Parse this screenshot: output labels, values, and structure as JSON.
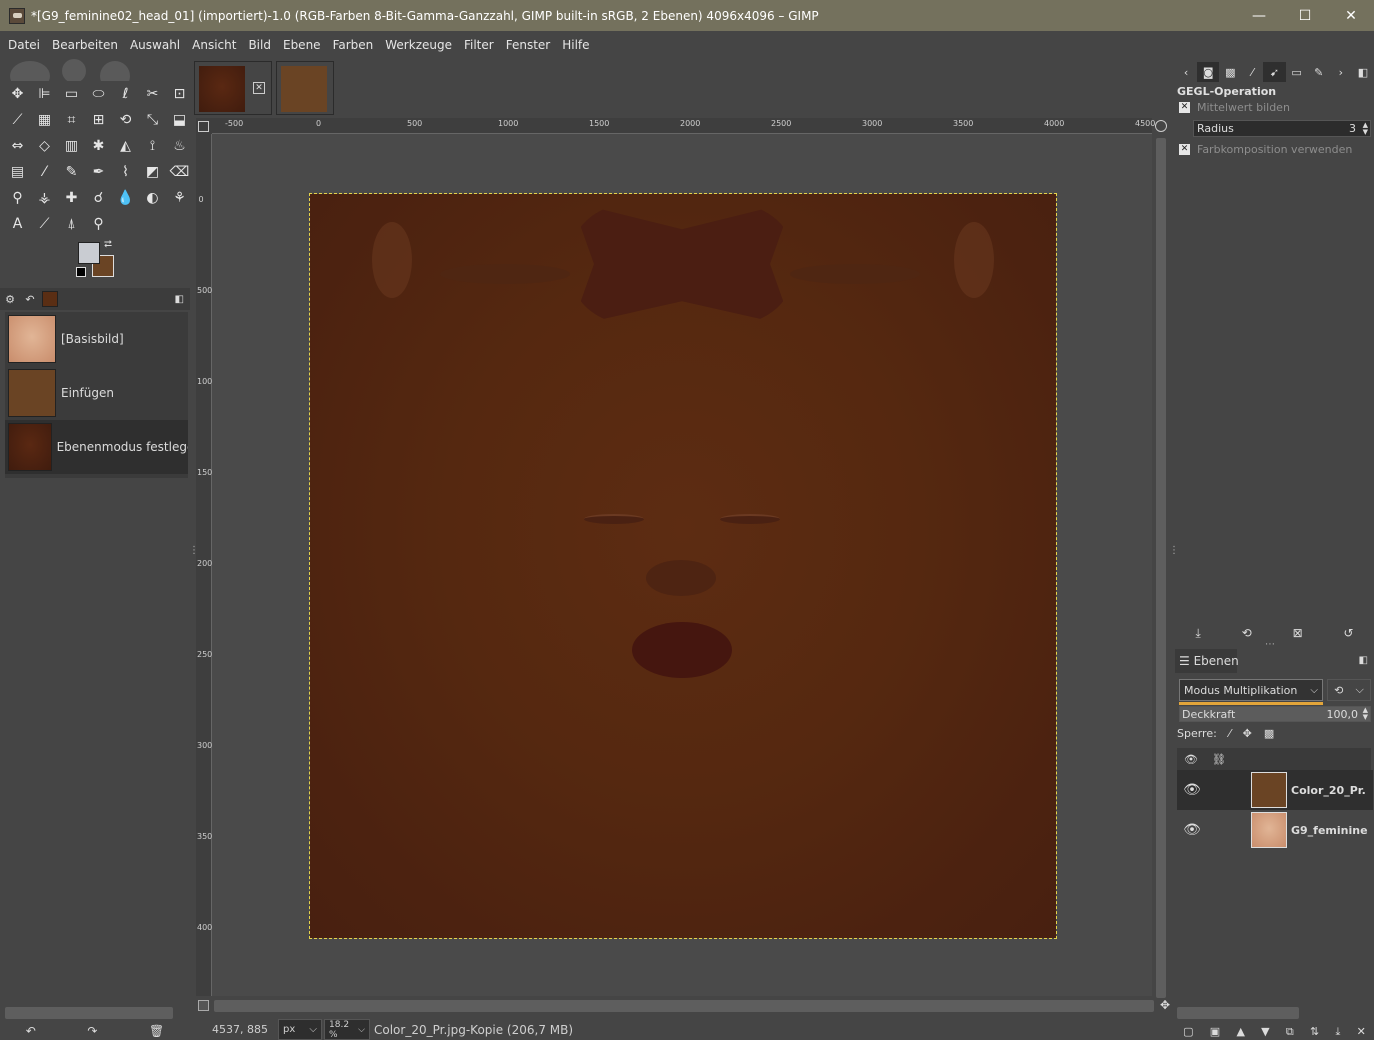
{
  "window": {
    "title": "*[G9_feminine02_head_01] (importiert)-1.0 (RGB-Farben 8-Bit-Gamma-Ganzzahl, GIMP built-in sRGB, 2 Ebenen) 4096x4096 – GIMP",
    "minimize": "—",
    "maximize": "☐",
    "close": "✕"
  },
  "menu": [
    "Datei",
    "Bearbeiten",
    "Auswahl",
    "Ansicht",
    "Bild",
    "Ebene",
    "Farben",
    "Werkzeuge",
    "Filter",
    "Fenster",
    "Hilfe"
  ],
  "toolbox": {
    "tools": [
      {
        "name": "move-tool-icon",
        "glyph": "✥"
      },
      {
        "name": "align-tool-icon",
        "glyph": "⊫"
      },
      {
        "name": "rect-select-icon",
        "glyph": "▭"
      },
      {
        "name": "ellipse-select-icon",
        "glyph": "⬭"
      },
      {
        "name": "free-select-icon",
        "glyph": "ℓ"
      },
      {
        "name": "scissors-select-icon",
        "glyph": "✂"
      },
      {
        "name": "foreground-select-icon",
        "glyph": "⊡"
      },
      {
        "name": "fuzzy-select-icon",
        "glyph": "⟋"
      },
      {
        "name": "color-select-icon",
        "glyph": "▦"
      },
      {
        "name": "crop-tool-icon",
        "glyph": "⌗"
      },
      {
        "name": "unified-transform-icon",
        "glyph": "⊞"
      },
      {
        "name": "warp-transform-icon",
        "glyph": "⟲"
      },
      {
        "name": "handle-transform-icon",
        "glyph": "⤡"
      },
      {
        "name": "shear-tool-icon",
        "glyph": "⬓"
      },
      {
        "name": "flip-tool-icon",
        "glyph": "⇔"
      },
      {
        "name": "perspective-tool-icon",
        "glyph": "◇"
      },
      {
        "name": "cage-transform-icon",
        "glyph": "▥"
      },
      {
        "name": "gegl-op-icon",
        "glyph": "✱"
      },
      {
        "name": "bucket-fill-icon",
        "glyph": "◭"
      },
      {
        "name": "paths-tool-icon",
        "glyph": "⟟"
      },
      {
        "name": "smudge-tool-icon",
        "glyph": "♨"
      },
      {
        "name": "gradient-tool-icon",
        "glyph": "▤"
      },
      {
        "name": "paintbrush-icon",
        "glyph": "⁄"
      },
      {
        "name": "pencil-icon",
        "glyph": "✎"
      },
      {
        "name": "airbrush-icon",
        "glyph": "✒"
      },
      {
        "name": "ink-tool-icon",
        "glyph": "⌇"
      },
      {
        "name": "mypaint-brush-icon",
        "glyph": "◩"
      },
      {
        "name": "eraser-icon",
        "glyph": "⌫"
      },
      {
        "name": "clone-tool-icon",
        "glyph": "⚲"
      },
      {
        "name": "perspective-clone-icon",
        "glyph": "⚶"
      },
      {
        "name": "heal-tool-icon",
        "glyph": "✚"
      },
      {
        "name": "smudge2-tool-icon",
        "glyph": "☌"
      },
      {
        "name": "blur-tool-icon",
        "glyph": "💧"
      },
      {
        "name": "dodge-burn-icon",
        "glyph": "◐"
      },
      {
        "name": "warp-paint-icon",
        "glyph": "⚘"
      },
      {
        "name": "text-tool-icon",
        "glyph": "A"
      },
      {
        "name": "color-picker-icon",
        "glyph": "⟋"
      },
      {
        "name": "measure-tool-icon",
        "glyph": "⍋"
      },
      {
        "name": "zoom-tool-icon",
        "glyph": "⚲"
      }
    ],
    "fg_color": "#c9ccd2",
    "bg_color": "#6a4424"
  },
  "undo_history": {
    "items": [
      {
        "label": "[Basisbild]",
        "thumb": "#d5a080"
      },
      {
        "label": "Einfügen",
        "thumb": "#6a4424"
      },
      {
        "label": "Ebenenmodus festlegen",
        "thumb": "#4a2210"
      }
    ]
  },
  "rulers": {
    "h_labels": [
      "-500",
      "0",
      "500",
      "1000",
      "1500",
      "2000",
      "2500",
      "3000",
      "3500",
      "4000",
      "4500"
    ],
    "v_labels": [
      "0",
      "500",
      "1000",
      "1500",
      "2000",
      "2500",
      "3000",
      "3500",
      "4000"
    ]
  },
  "statusbar": {
    "coords": "4537, 885",
    "unit": "px",
    "zoom": "18.2 %",
    "message": "Color_20_Pr.jpg-Kopie (206,7 MB)"
  },
  "gegl_panel": {
    "title": "GEGL-Operation",
    "option1": "Mittelwert bilden",
    "radius_label": "Radius",
    "radius_value": "3",
    "option2": "Farbkomposition verwenden"
  },
  "layers_panel": {
    "tab_label": "Ebenen",
    "mode_label": "Modus",
    "mode_value": "Multiplikation",
    "opacity_label": "Deckkraft",
    "opacity_value": "100,0",
    "opacity_fraction": 1.0,
    "lock_label": "Sperre:",
    "layers": [
      {
        "name": "Color_20_Pr.",
        "thumb": "#6a4424",
        "selected": true
      },
      {
        "name": "G9_feminine",
        "thumb": "#d5a080",
        "selected": false
      }
    ]
  }
}
